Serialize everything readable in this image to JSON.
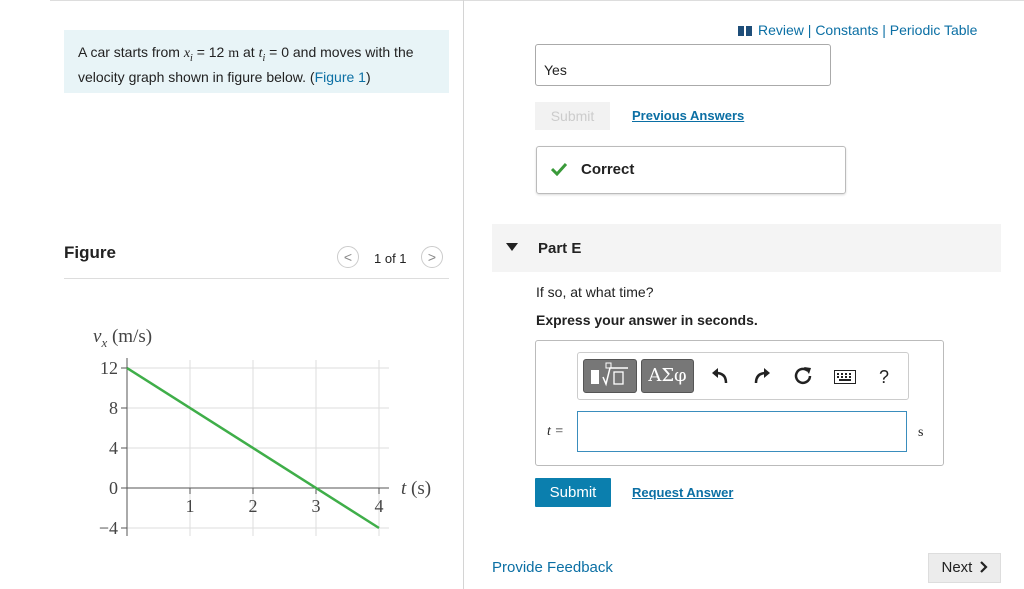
{
  "problem": {
    "text_1": "A car starts from ",
    "x_i": "x",
    "x_sub": "i",
    "eq_1": " = 12 ",
    "unit_m": "m",
    "text_2": " at ",
    "t_i": "t",
    "t_sub": "i",
    "text_3": " = 0 and moves with the velocity graph shown in figure below. (",
    "figure_link": "Figure 1",
    "text_4": ")"
  },
  "figure": {
    "title": "Figure",
    "prev": "<",
    "next": ">",
    "count": "1 of 1"
  },
  "chart_data": {
    "type": "line",
    "xlabel": "t (s)",
    "ylabel": "v_x (m/s)",
    "x_ticks": [
      "1",
      "2",
      "3",
      "4"
    ],
    "y_ticks": [
      "12",
      "8",
      "4",
      "0",
      "−4"
    ],
    "xlim": [
      0,
      4
    ],
    "ylim": [
      -4,
      12
    ],
    "grid": true,
    "series": [
      {
        "x": [
          0,
          4
        ],
        "y": [
          12,
          -4
        ],
        "color": "#3fae49"
      }
    ]
  },
  "header": {
    "review_icon": "book-icon",
    "links": "Review | Constants | Periodic Table"
  },
  "prev_part": {
    "answer": "Yes",
    "submit": "Submit",
    "previous_answers": "Previous Answers",
    "status": "Correct",
    "status_color": "#3a9a3a"
  },
  "part_e": {
    "label": "Part E",
    "question": "If so, at what time?",
    "instruction": "Express your answer in seconds.",
    "toolbar": {
      "templates_icon": "templates-icon",
      "greek": "ΑΣφ",
      "undo_icon": "undo-icon",
      "redo_icon": "redo-icon",
      "reset_icon": "reset-icon",
      "keyboard_icon": "keyboard-icon",
      "help": "?"
    },
    "variable": "t =",
    "input_value": "",
    "unit": "s",
    "submit": "Submit",
    "request_answer": "Request Answer"
  },
  "footer": {
    "feedback": "Provide Feedback",
    "next": "Next"
  }
}
